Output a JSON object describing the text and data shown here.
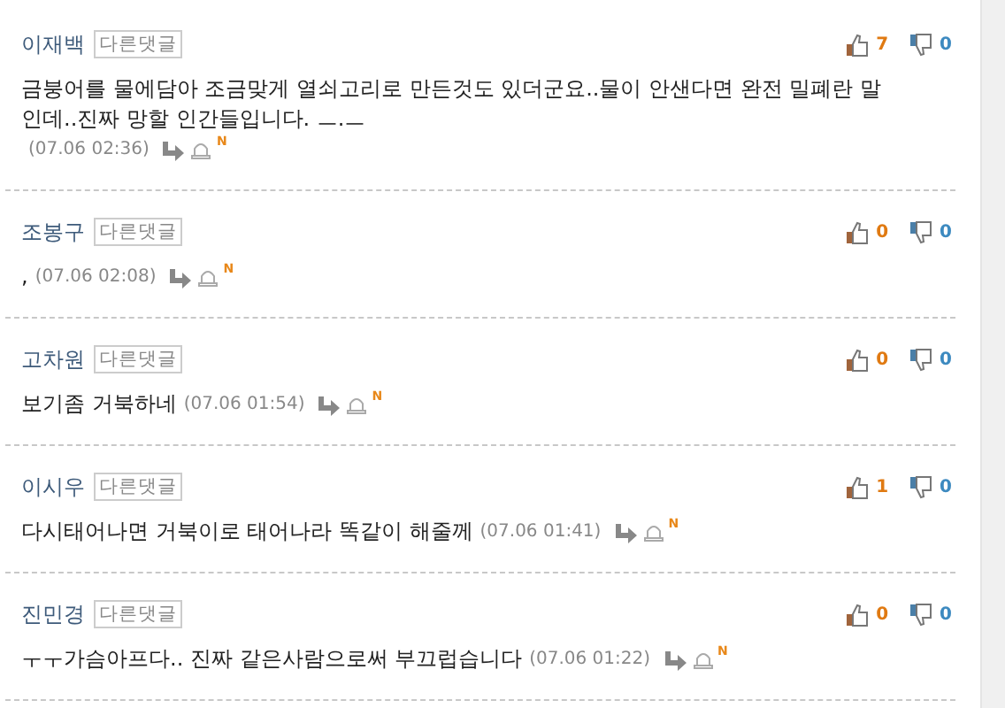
{
  "comments": [
    {
      "author": "이재백",
      "badge": "다른댓글",
      "text": "금붕어를 물에담아 조금맞게 열쇠고리로 만든것도 있더군요..물이 안샌다면 완전 밀폐란 말인데..진짜 망할 인간들입니다. ㅡ.ㅡ",
      "time": "(07.06 02:36)",
      "new": "N",
      "likes": "7",
      "dislikes": "0"
    },
    {
      "author": "조봉구",
      "badge": "다른댓글",
      "text": ",",
      "time": "(07.06 02:08)",
      "new": "N",
      "likes": "0",
      "dislikes": "0"
    },
    {
      "author": "고차원",
      "badge": "다른댓글",
      "text": "보기좀 거북하네",
      "time": "(07.06 01:54)",
      "new": "N",
      "likes": "0",
      "dislikes": "0"
    },
    {
      "author": "이시우",
      "badge": "다른댓글",
      "text": "다시태어나면 거북이로 태어나라 똑같이 해줄께",
      "time": "(07.06 01:41)",
      "new": "N",
      "likes": "1",
      "dislikes": "0"
    },
    {
      "author": "진민경",
      "badge": "다른댓글",
      "text": "ㅜㅜ가슴아프다.. 진짜 같은사람으로써 부끄럽습니다",
      "time": "(07.06 01:22)",
      "new": "N",
      "likes": "0",
      "dislikes": "0"
    }
  ]
}
